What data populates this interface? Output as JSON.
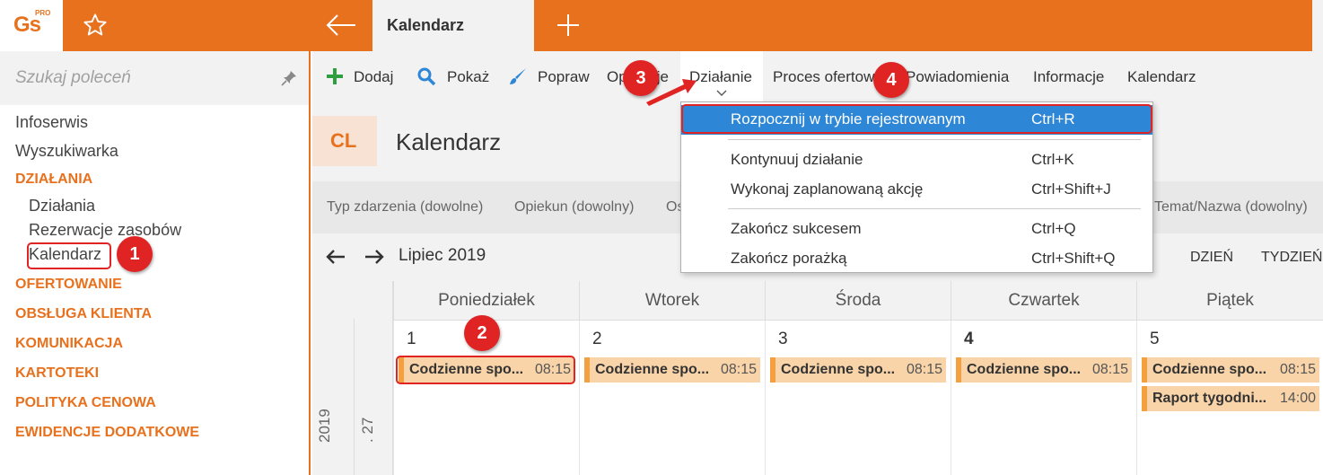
{
  "header": {
    "logo": "Gs",
    "logo_badge": "PRO",
    "tab_title": "Kalendarz"
  },
  "sidebar": {
    "search_placeholder": "Szukaj poleceń",
    "items": [
      "Infoserwis",
      "Wyszukiwarka"
    ],
    "section_dzialania": "DZIAŁANIA",
    "sub_items": [
      "Działania",
      "Rezerwacje zasobów",
      "Kalendarz"
    ],
    "sections": [
      "OFERTOWANIE",
      "OBSŁUGA KLIENTA",
      "KOMUNIKACJA",
      "KARTOTEKI",
      "POLITYKA CENOWA",
      "EWIDENCJE DODATKOWE"
    ]
  },
  "toolbar": {
    "add": "Dodaj",
    "show": "Pokaż",
    "edit": "Popraw",
    "operations": "Operacje",
    "action": "Działanie",
    "offer_process": "Proces ofertowy",
    "notifications": "Powiadomienia",
    "info": "Informacje",
    "calendar": "Kalendarz"
  },
  "page": {
    "badge": "CL",
    "title": "Kalendarz"
  },
  "filters": {
    "event_type": "Typ zdarzenia (dowolne)",
    "owner": "Opiekun (dowolny)",
    "partial": "Os",
    "subject": "Temat/Nazwa (dowolny)"
  },
  "calendar": {
    "month": "Lipiec 2019",
    "view_day": "DZIEŃ",
    "view_week": "TYDZIEŃ",
    "year": "2019",
    "week": ". 27",
    "days": [
      {
        "name": "Poniedziałek",
        "num": "1",
        "events": [
          {
            "title": "Codzienne spo...",
            "time": "08:15"
          }
        ]
      },
      {
        "name": "Wtorek",
        "num": "2",
        "events": [
          {
            "title": "Codzienne spo...",
            "time": "08:15"
          }
        ]
      },
      {
        "name": "Środa",
        "num": "3",
        "events": [
          {
            "title": "Codzienne spo...",
            "time": "08:15"
          }
        ]
      },
      {
        "name": "Czwartek",
        "num": "4",
        "events": [
          {
            "title": "Codzienne spo...",
            "time": "08:15"
          }
        ]
      },
      {
        "name": "Piątek",
        "num": "5",
        "events": [
          {
            "title": "Codzienne spo...",
            "time": "08:15"
          },
          {
            "title": "Raport tygodni...",
            "time": "14:00"
          }
        ]
      }
    ]
  },
  "dropdown": {
    "items": [
      {
        "label": "Rozpocznij w trybie rejestrowanym",
        "shortcut": "Ctrl+R"
      },
      {
        "label": "Kontynuuj działanie",
        "shortcut": "Ctrl+K"
      },
      {
        "label": "Wykonaj zaplanowaną akcję",
        "shortcut": "Ctrl+Shift+J"
      },
      {
        "label": "Zakończ sukcesem",
        "shortcut": "Ctrl+Q"
      },
      {
        "label": "Zakończ porażką",
        "shortcut": "Ctrl+Shift+Q"
      }
    ]
  },
  "markers": [
    "1",
    "2",
    "3",
    "4"
  ],
  "colors": {
    "accent": "#E8711E",
    "highlight": "#2E86D6",
    "annotation": "#E02424",
    "event_bg": "#F9D4A8"
  }
}
